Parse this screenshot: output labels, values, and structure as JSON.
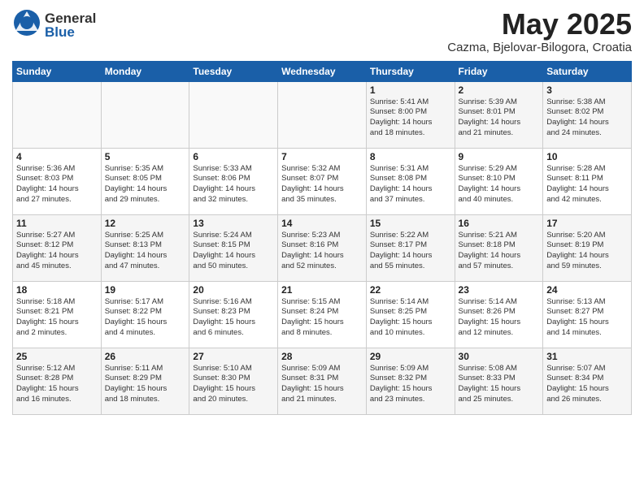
{
  "header": {
    "logo_general": "General",
    "logo_blue": "Blue",
    "title": "May 2025",
    "location": "Cazma, Bjelovar-Bilogora, Croatia"
  },
  "days_of_week": [
    "Sunday",
    "Monday",
    "Tuesday",
    "Wednesday",
    "Thursday",
    "Friday",
    "Saturday"
  ],
  "weeks": [
    [
      {
        "day": "",
        "info": ""
      },
      {
        "day": "",
        "info": ""
      },
      {
        "day": "",
        "info": ""
      },
      {
        "day": "",
        "info": ""
      },
      {
        "day": "1",
        "info": "Sunrise: 5:41 AM\nSunset: 8:00 PM\nDaylight: 14 hours\nand 18 minutes."
      },
      {
        "day": "2",
        "info": "Sunrise: 5:39 AM\nSunset: 8:01 PM\nDaylight: 14 hours\nand 21 minutes."
      },
      {
        "day": "3",
        "info": "Sunrise: 5:38 AM\nSunset: 8:02 PM\nDaylight: 14 hours\nand 24 minutes."
      }
    ],
    [
      {
        "day": "4",
        "info": "Sunrise: 5:36 AM\nSunset: 8:03 PM\nDaylight: 14 hours\nand 27 minutes."
      },
      {
        "day": "5",
        "info": "Sunrise: 5:35 AM\nSunset: 8:05 PM\nDaylight: 14 hours\nand 29 minutes."
      },
      {
        "day": "6",
        "info": "Sunrise: 5:33 AM\nSunset: 8:06 PM\nDaylight: 14 hours\nand 32 minutes."
      },
      {
        "day": "7",
        "info": "Sunrise: 5:32 AM\nSunset: 8:07 PM\nDaylight: 14 hours\nand 35 minutes."
      },
      {
        "day": "8",
        "info": "Sunrise: 5:31 AM\nSunset: 8:08 PM\nDaylight: 14 hours\nand 37 minutes."
      },
      {
        "day": "9",
        "info": "Sunrise: 5:29 AM\nSunset: 8:10 PM\nDaylight: 14 hours\nand 40 minutes."
      },
      {
        "day": "10",
        "info": "Sunrise: 5:28 AM\nSunset: 8:11 PM\nDaylight: 14 hours\nand 42 minutes."
      }
    ],
    [
      {
        "day": "11",
        "info": "Sunrise: 5:27 AM\nSunset: 8:12 PM\nDaylight: 14 hours\nand 45 minutes."
      },
      {
        "day": "12",
        "info": "Sunrise: 5:25 AM\nSunset: 8:13 PM\nDaylight: 14 hours\nand 47 minutes."
      },
      {
        "day": "13",
        "info": "Sunrise: 5:24 AM\nSunset: 8:15 PM\nDaylight: 14 hours\nand 50 minutes."
      },
      {
        "day": "14",
        "info": "Sunrise: 5:23 AM\nSunset: 8:16 PM\nDaylight: 14 hours\nand 52 minutes."
      },
      {
        "day": "15",
        "info": "Sunrise: 5:22 AM\nSunset: 8:17 PM\nDaylight: 14 hours\nand 55 minutes."
      },
      {
        "day": "16",
        "info": "Sunrise: 5:21 AM\nSunset: 8:18 PM\nDaylight: 14 hours\nand 57 minutes."
      },
      {
        "day": "17",
        "info": "Sunrise: 5:20 AM\nSunset: 8:19 PM\nDaylight: 14 hours\nand 59 minutes."
      }
    ],
    [
      {
        "day": "18",
        "info": "Sunrise: 5:18 AM\nSunset: 8:21 PM\nDaylight: 15 hours\nand 2 minutes."
      },
      {
        "day": "19",
        "info": "Sunrise: 5:17 AM\nSunset: 8:22 PM\nDaylight: 15 hours\nand 4 minutes."
      },
      {
        "day": "20",
        "info": "Sunrise: 5:16 AM\nSunset: 8:23 PM\nDaylight: 15 hours\nand 6 minutes."
      },
      {
        "day": "21",
        "info": "Sunrise: 5:15 AM\nSunset: 8:24 PM\nDaylight: 15 hours\nand 8 minutes."
      },
      {
        "day": "22",
        "info": "Sunrise: 5:14 AM\nSunset: 8:25 PM\nDaylight: 15 hours\nand 10 minutes."
      },
      {
        "day": "23",
        "info": "Sunrise: 5:14 AM\nSunset: 8:26 PM\nDaylight: 15 hours\nand 12 minutes."
      },
      {
        "day": "24",
        "info": "Sunrise: 5:13 AM\nSunset: 8:27 PM\nDaylight: 15 hours\nand 14 minutes."
      }
    ],
    [
      {
        "day": "25",
        "info": "Sunrise: 5:12 AM\nSunset: 8:28 PM\nDaylight: 15 hours\nand 16 minutes."
      },
      {
        "day": "26",
        "info": "Sunrise: 5:11 AM\nSunset: 8:29 PM\nDaylight: 15 hours\nand 18 minutes."
      },
      {
        "day": "27",
        "info": "Sunrise: 5:10 AM\nSunset: 8:30 PM\nDaylight: 15 hours\nand 20 minutes."
      },
      {
        "day": "28",
        "info": "Sunrise: 5:09 AM\nSunset: 8:31 PM\nDaylight: 15 hours\nand 21 minutes."
      },
      {
        "day": "29",
        "info": "Sunrise: 5:09 AM\nSunset: 8:32 PM\nDaylight: 15 hours\nand 23 minutes."
      },
      {
        "day": "30",
        "info": "Sunrise: 5:08 AM\nSunset: 8:33 PM\nDaylight: 15 hours\nand 25 minutes."
      },
      {
        "day": "31",
        "info": "Sunrise: 5:07 AM\nSunset: 8:34 PM\nDaylight: 15 hours\nand 26 minutes."
      }
    ]
  ]
}
